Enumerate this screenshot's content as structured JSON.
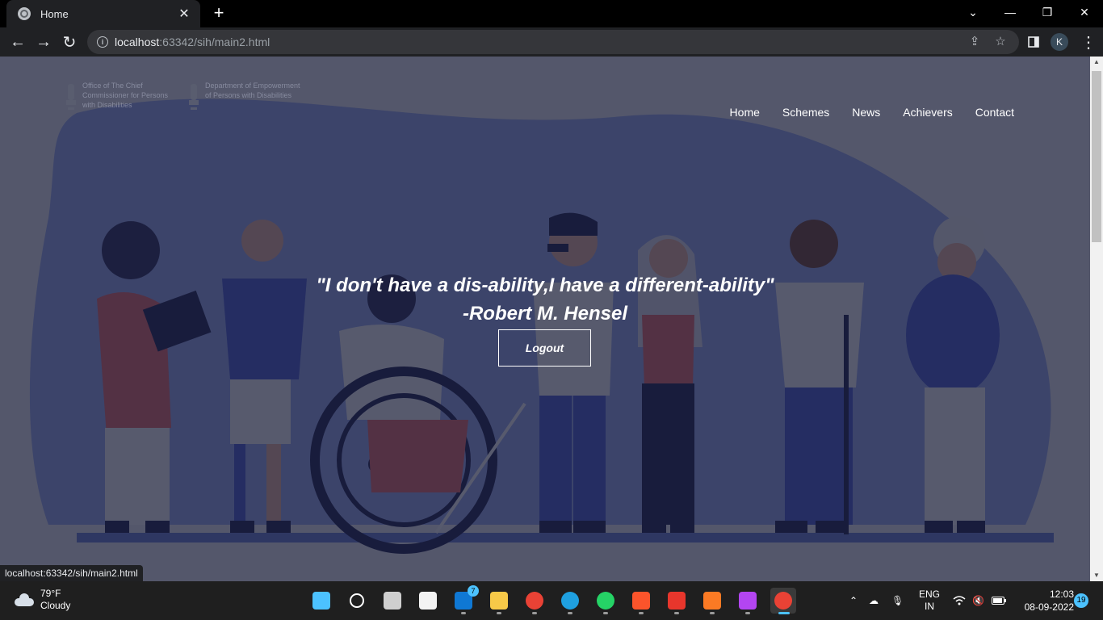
{
  "browser": {
    "tab_title": "Home",
    "url_host": "localhost",
    "url_rest": ":63342/sih/main2.html",
    "profile_initial": "K",
    "status_url": "localhost:63342/sih/main2.html"
  },
  "page": {
    "logos": [
      {
        "text": "Office of The Chief Commissioner for Persons with Disabilities"
      },
      {
        "text": "Department of Empowerment of Persons with Disabilities"
      }
    ],
    "nav": [
      {
        "label": "Home"
      },
      {
        "label": "Schemes"
      },
      {
        "label": "News"
      },
      {
        "label": "Achievers"
      },
      {
        "label": "Contact"
      }
    ],
    "quote_line1": "\"I don't have a dis-ability,I have a different-ability\"",
    "quote_line2": "-Robert M. Hensel",
    "logout_label": "Logout"
  },
  "taskbar": {
    "weather_temp": "79°F",
    "weather_desc": "Cloudy",
    "apps": [
      {
        "name": "start-icon",
        "color": "#4cc2ff"
      },
      {
        "name": "search-icon",
        "color": "#ffffff"
      },
      {
        "name": "task-view-icon",
        "color": "#cfcfcf"
      },
      {
        "name": "store-icon",
        "color": "#f3f3f3"
      },
      {
        "name": "mail-icon",
        "color": "#0f78d4",
        "badge": "7"
      },
      {
        "name": "file-explorer-icon",
        "color": "#f7c948"
      },
      {
        "name": "chrome-icon",
        "color": "#e94235"
      },
      {
        "name": "edge-icon",
        "color": "#1fa0e0"
      },
      {
        "name": "whatsapp-icon",
        "color": "#25d366"
      },
      {
        "name": "brave-icon",
        "color": "#fb542b"
      },
      {
        "name": "wps-office-icon",
        "color": "#e8362c"
      },
      {
        "name": "xampp-icon",
        "color": "#fb7a24"
      },
      {
        "name": "phpstorm-icon",
        "color": "#b345f1"
      },
      {
        "name": "chrome-profile-icon",
        "color": "#e94235"
      }
    ],
    "language": "ENG",
    "region": "IN",
    "time": "12:03",
    "date": "08-09-2022",
    "notification_count": "19"
  }
}
